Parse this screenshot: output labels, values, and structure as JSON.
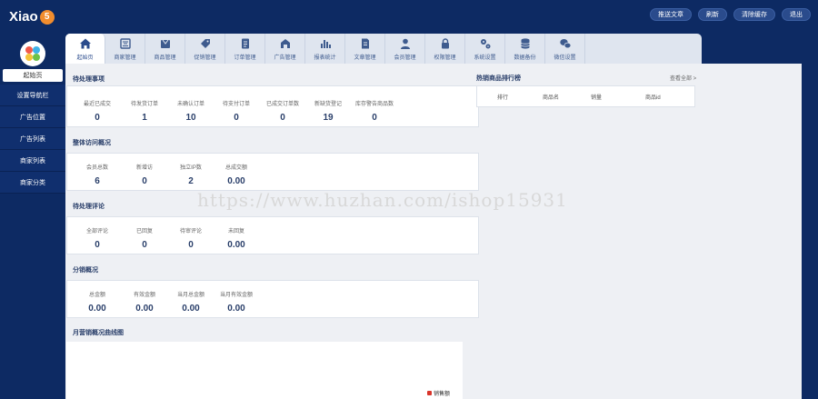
{
  "logo": {
    "text": "Xiao",
    "badge": "5"
  },
  "top_actions": [
    "推送文章",
    "刷新",
    "清除缓存",
    "退出"
  ],
  "sidebar": {
    "items": [
      "起始页",
      "设置导航栏",
      "广告位置",
      "广告列表",
      "商家列表",
      "商家分类"
    ]
  },
  "tabs": [
    {
      "label": "起始页",
      "icon": "home-icon"
    },
    {
      "label": "商家管理",
      "icon": "shop-icon"
    },
    {
      "label": "商品管理",
      "icon": "goods-icon"
    },
    {
      "label": "促销管理",
      "icon": "tag-icon"
    },
    {
      "label": "订单管理",
      "icon": "order-icon"
    },
    {
      "label": "广告管理",
      "icon": "ad-icon"
    },
    {
      "label": "报表统计",
      "icon": "chart-icon"
    },
    {
      "label": "文章管理",
      "icon": "article-icon"
    },
    {
      "label": "会员管理",
      "icon": "member-icon"
    },
    {
      "label": "权限管理",
      "icon": "lock-icon"
    },
    {
      "label": "系统设置",
      "icon": "gear-icon"
    },
    {
      "label": "数据备份",
      "icon": "database-icon"
    },
    {
      "label": "微信设置",
      "icon": "wechat-icon"
    }
  ],
  "sections": {
    "todo": {
      "title": "待处理事项",
      "stats": [
        {
          "label": "最近已成交",
          "value": "0"
        },
        {
          "label": "待发货订单",
          "value": "1"
        },
        {
          "label": "未确认订单",
          "value": "10"
        },
        {
          "label": "待支付订单",
          "value": "0"
        },
        {
          "label": "已成交订单数",
          "value": "0"
        },
        {
          "label": "新缺货登记",
          "value": "19"
        },
        {
          "label": "库存警告商品数",
          "value": "0"
        }
      ]
    },
    "overview": {
      "title": "整体访问概况",
      "stats": [
        {
          "label": "会员总数",
          "value": "6"
        },
        {
          "label": "新增访",
          "value": "0"
        },
        {
          "label": "独立IP数",
          "value": "2"
        },
        {
          "label": "总成交额",
          "value": "0.00"
        }
      ]
    },
    "comments": {
      "title": "待处理评论",
      "stats": [
        {
          "label": "全部评论",
          "value": "0"
        },
        {
          "label": "已回复",
          "value": "0"
        },
        {
          "label": "待审评论",
          "value": "0"
        },
        {
          "label": "未回复",
          "value": "0.00"
        }
      ]
    },
    "sales": {
      "title": "分销概况",
      "stats": [
        {
          "label": "总金额",
          "value": "0.00"
        },
        {
          "label": "有效金额",
          "value": "0.00"
        },
        {
          "label": "当月总金额",
          "value": "0.00"
        },
        {
          "label": "当月有效金额",
          "value": "0.00"
        }
      ]
    },
    "trend": {
      "title": "月营销概况曲线图",
      "legend": "销售额"
    }
  },
  "ranking": {
    "title": "热销商品排行榜",
    "more": "查看全部 >",
    "columns": [
      "排行",
      "商品名",
      "销量",
      "商品id"
    ]
  },
  "watermark": "https://www.huzhan.com/ishop15931"
}
